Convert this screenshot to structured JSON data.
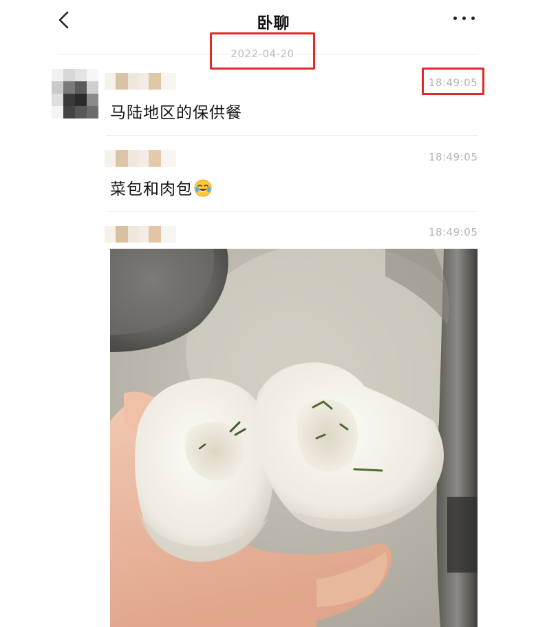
{
  "header": {
    "title": "卧聊"
  },
  "date_separator": "2022-04-20",
  "messages": [
    {
      "time": "18:49:05",
      "text": "马陆地区的保供餐"
    },
    {
      "time": "18:49:05",
      "text": "菜包和肉包"
    },
    {
      "time": "18:49:05",
      "image": "steamed-buns-photo"
    }
  ],
  "colors": {
    "highlight_box": "#e6252a",
    "timestamp": "#b4b4b4",
    "divider": "#ececec"
  }
}
